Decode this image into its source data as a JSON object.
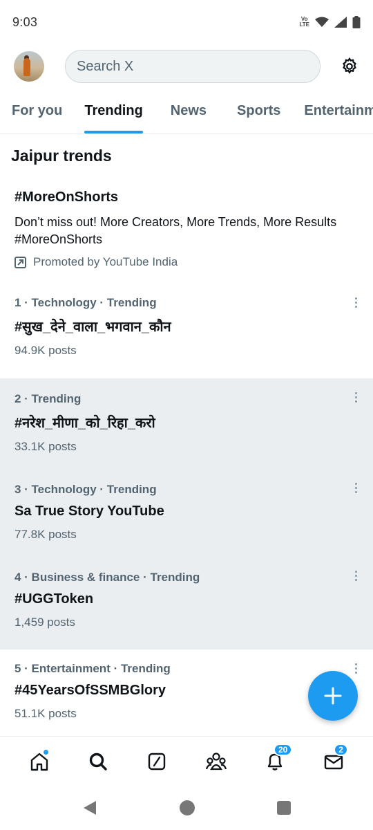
{
  "status_bar": {
    "time": "9:03",
    "network_label_top": "Vo",
    "network_label_bottom": "LTE"
  },
  "header": {
    "search_placeholder": "Search X"
  },
  "tabs": [
    {
      "label": "For you",
      "active": false
    },
    {
      "label": "Trending",
      "active": true
    },
    {
      "label": "News",
      "active": false
    },
    {
      "label": "Sports",
      "active": false
    },
    {
      "label": "Entertainment",
      "active": false
    }
  ],
  "section_title": "Jaipur trends",
  "promoted": {
    "hashtag": "#MoreOnShorts",
    "description": "Don’t miss out! More Creators, More Trends, More Results #MoreOnShorts",
    "by": "Promoted by YouTube India"
  },
  "trends": [
    {
      "meta": "1 · Technology · Trending",
      "name": "#सुख_देने_वाला_भगवान_कौन",
      "count": "94.9K posts"
    },
    {
      "meta": "2 · Trending",
      "name": "#नरेश_मीणा_को_रिहा_करो",
      "count": "33.1K posts"
    },
    {
      "meta": "3 · Technology · Trending",
      "name": "Sa True Story YouTube",
      "count": "77.8K posts"
    },
    {
      "meta": "4 · Business & finance · Trending",
      "name": "#UGGToken",
      "count": "1,459 posts"
    },
    {
      "meta": "5 · Entertainment · Trending",
      "name": "#45YearsOfSSMBGlory",
      "count": "51.1K posts"
    }
  ],
  "bottom_nav": {
    "notifications_badge": "20",
    "messages_badge": "2"
  },
  "colors": {
    "accent": "#1d9bf0",
    "shaded_row": "#ebeef0",
    "secondary_text": "#536471"
  }
}
